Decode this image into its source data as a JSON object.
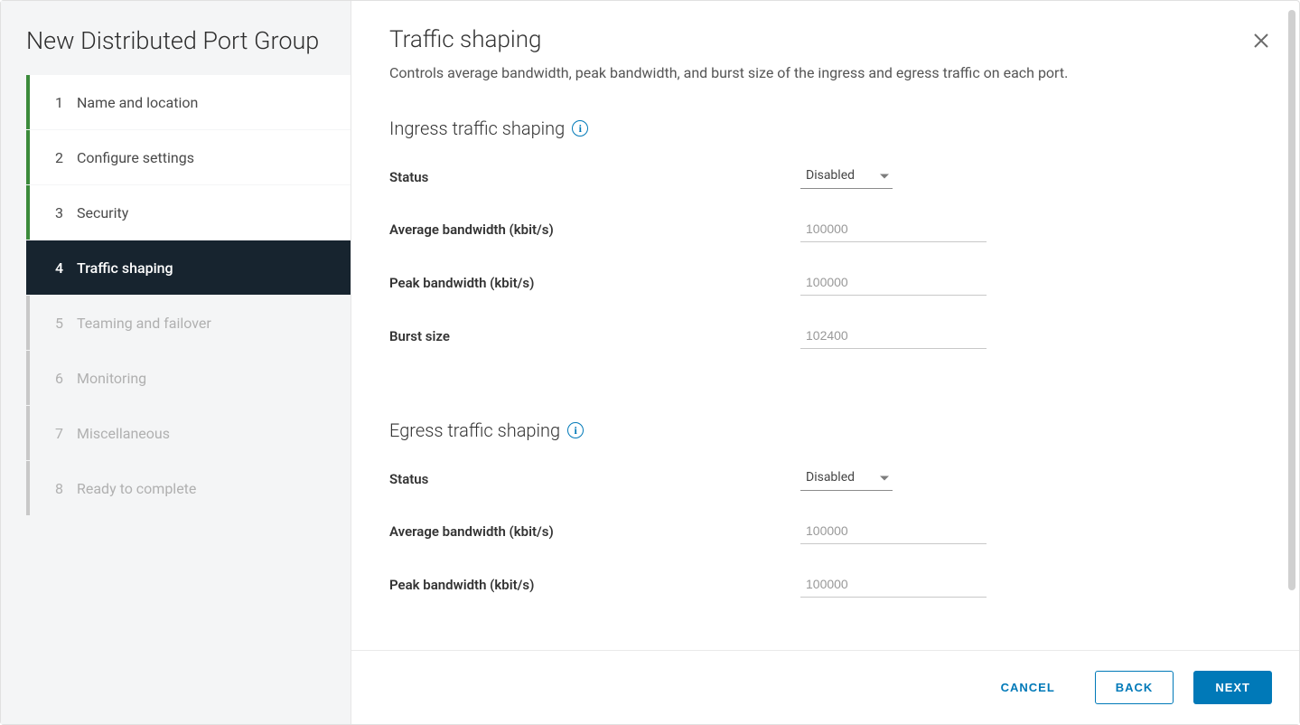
{
  "sidebar": {
    "title": "New Distributed Port Group",
    "steps": [
      {
        "num": "1",
        "label": "Name and location",
        "state": "completed"
      },
      {
        "num": "2",
        "label": "Configure settings",
        "state": "completed"
      },
      {
        "num": "3",
        "label": "Security",
        "state": "completed"
      },
      {
        "num": "4",
        "label": "Traffic shaping",
        "state": "active"
      },
      {
        "num": "5",
        "label": "Teaming and failover",
        "state": "pending"
      },
      {
        "num": "6",
        "label": "Monitoring",
        "state": "pending"
      },
      {
        "num": "7",
        "label": "Miscellaneous",
        "state": "pending"
      },
      {
        "num": "8",
        "label": "Ready to complete",
        "state": "pending"
      }
    ]
  },
  "page": {
    "title": "Traffic shaping",
    "description": "Controls average bandwidth, peak bandwidth, and burst size of the ingress and egress traffic on each port."
  },
  "ingress": {
    "section_title": "Ingress traffic shaping",
    "status_label": "Status",
    "status_value": "Disabled",
    "avg_bw_label": "Average bandwidth (kbit/s)",
    "avg_bw_placeholder": "100000",
    "peak_bw_label": "Peak bandwidth (kbit/s)",
    "peak_bw_placeholder": "100000",
    "burst_label": "Burst size",
    "burst_placeholder": "102400"
  },
  "egress": {
    "section_title": "Egress traffic shaping",
    "status_label": "Status",
    "status_value": "Disabled",
    "avg_bw_label": "Average bandwidth (kbit/s)",
    "avg_bw_placeholder": "100000",
    "peak_bw_label": "Peak bandwidth (kbit/s)",
    "peak_bw_placeholder": "100000"
  },
  "footer": {
    "cancel": "CANCEL",
    "back": "BACK",
    "next": "NEXT"
  },
  "info_glyph": "i"
}
